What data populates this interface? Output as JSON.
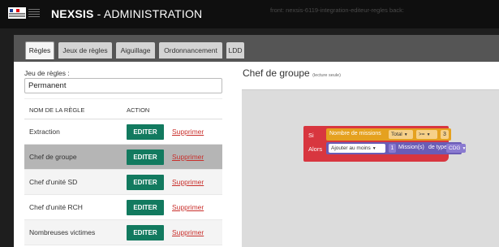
{
  "header": {
    "title_bold": "NEXSIS",
    "title_rest": " - ADMINISTRATION",
    "env_info": "front: nexsis-6119-integration-editeur-regles   back:"
  },
  "tabs": [
    {
      "label": "Règles",
      "active": true
    },
    {
      "label": "Jeux de règles",
      "active": false
    },
    {
      "label": "Aiguillage",
      "active": false
    },
    {
      "label": "Ordonnancement",
      "active": false
    },
    {
      "label": "LDD",
      "active": false
    }
  ],
  "ruleset": {
    "label": "Jeu de règles :",
    "value": "Permanent"
  },
  "table": {
    "col_name": "NOM DE LA RÈGLE",
    "col_action": "ACTION",
    "edit_label": "EDITER",
    "delete_label": "Supprimer",
    "rows": [
      {
        "name": "Extraction"
      },
      {
        "name": "Chef de groupe",
        "selected": true
      },
      {
        "name": "Chef d'unité SD"
      },
      {
        "name": "Chef d'unité RCH"
      },
      {
        "name": "Nombreuses victimes"
      }
    ]
  },
  "rule": {
    "title": "Chef de groupe",
    "subtitle": "(lecture seule)",
    "si": "Si",
    "alors": "Alors",
    "condition_text": "Nombre de missions",
    "condition_dropdown": "Total",
    "operator_dropdown": ">=",
    "condition_value": "3",
    "action_dropdown": "Ajouter au moins",
    "action_count": "1",
    "mission_text": "Mission(s)",
    "type_text": "de type",
    "type_dropdown": "CDG"
  },
  "colors": {
    "edit_button": "#127a5f",
    "delete_link": "#c9302c",
    "rule_block": "#d8363f",
    "condition_block": "#e5a11f",
    "action_block": "#6a5cb6"
  },
  "icons": [
    "french-republic-logo",
    "dropdown-caret-icon"
  ]
}
